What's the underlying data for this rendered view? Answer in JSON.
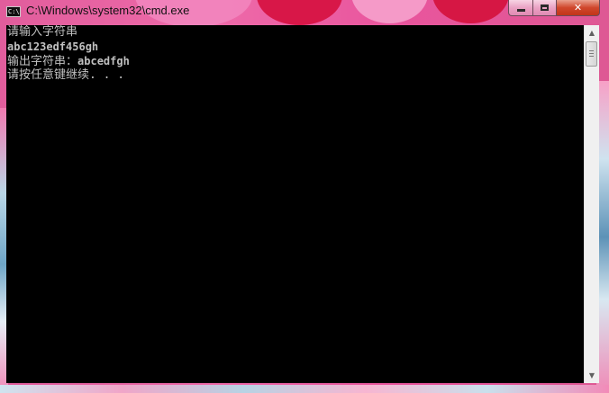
{
  "window": {
    "title": "C:\\Windows\\system32\\cmd.exe",
    "icon_text": "C:\\"
  },
  "console": {
    "lines": {
      "prompt": "请输入字符串",
      "input": "abc123edf456gh",
      "output_label": "输出字符串：",
      "output_value": "abcedfgh",
      "continue": "请按任意键继续. . ."
    }
  },
  "colors": {
    "console_bg": "#000000",
    "console_text": "#c0c0c0",
    "close_button": "#c23518",
    "frame_pink": "#e15d9c"
  },
  "icons": {
    "app": "cmd-icon",
    "minimize": "minimize-icon",
    "maximize": "maximize-icon",
    "close": "close-icon",
    "scroll_up": "arrow-up-icon",
    "scroll_down": "arrow-down-icon"
  }
}
